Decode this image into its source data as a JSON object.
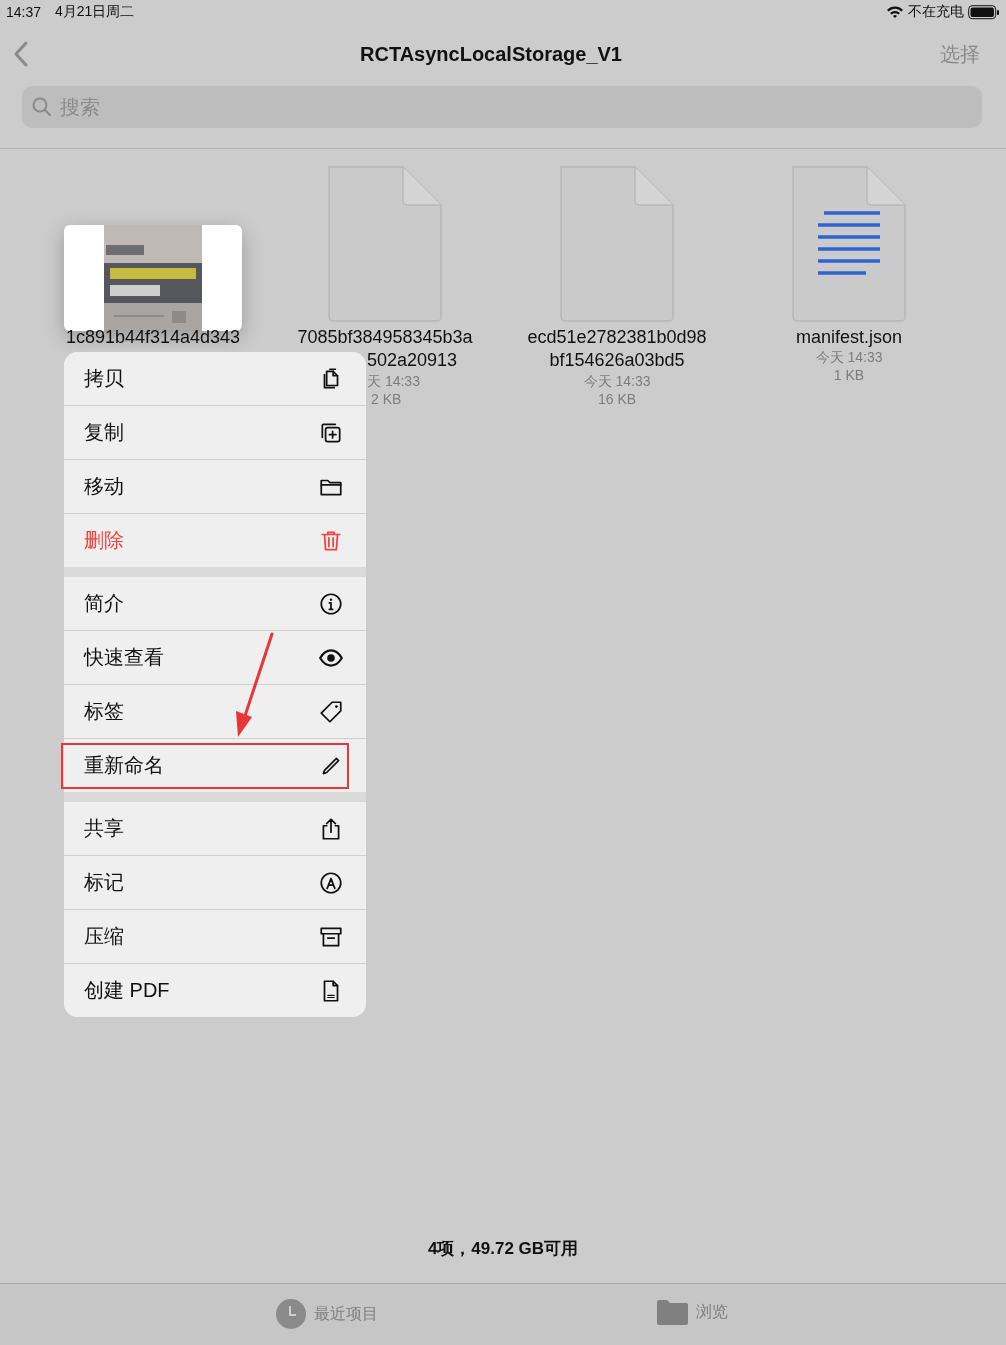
{
  "status_bar": {
    "time": "14:37",
    "date": "4月21日周二",
    "charging": "不在充电"
  },
  "nav": {
    "title": "RCTAsyncLocalStorage_V1",
    "select": "选择"
  },
  "search": {
    "placeholder": "搜索"
  },
  "files": [
    {
      "kind": "picture",
      "lines": [
        "1c891b44f314a4d343"
      ]
    },
    {
      "kind": "blank",
      "lines": [
        "7085bf384958345b3a",
        "502a20913"
      ],
      "date": "天 14:33",
      "size": "2 KB"
    },
    {
      "kind": "blank",
      "lines": [
        "ecd51e2782381b0d98",
        "bf154626a03bd5"
      ],
      "date": "今天 14:33",
      "size": "16 KB"
    },
    {
      "kind": "text",
      "lines": [
        "manifest.json"
      ],
      "date": "今天 14:33",
      "size": "1 KB"
    }
  ],
  "menu": {
    "groups": [
      [
        {
          "label": "拷贝",
          "destructive": false,
          "highlighted": false
        },
        {
          "label": "复制",
          "destructive": false,
          "highlighted": false
        },
        {
          "label": "移动",
          "destructive": false,
          "highlighted": false
        },
        {
          "label": "删除",
          "destructive": true,
          "highlighted": false
        }
      ],
      [
        {
          "label": "简介",
          "destructive": false,
          "highlighted": false
        },
        {
          "label": "快速查看",
          "destructive": false,
          "highlighted": false
        },
        {
          "label": "标签",
          "destructive": false,
          "highlighted": false
        },
        {
          "label": "重新命名",
          "destructive": false,
          "highlighted": true
        }
      ],
      [
        {
          "label": "共享",
          "destructive": false,
          "highlighted": false
        },
        {
          "label": "标记",
          "destructive": false,
          "highlighted": false
        },
        {
          "label": "压缩",
          "destructive": false,
          "highlighted": false
        },
        {
          "label": "创建 PDF",
          "destructive": false,
          "highlighted": false
        }
      ]
    ]
  },
  "footer": "4项，49.72 GB可用",
  "tabs": [
    {
      "label": "最近项目"
    },
    {
      "label": "浏览"
    }
  ]
}
